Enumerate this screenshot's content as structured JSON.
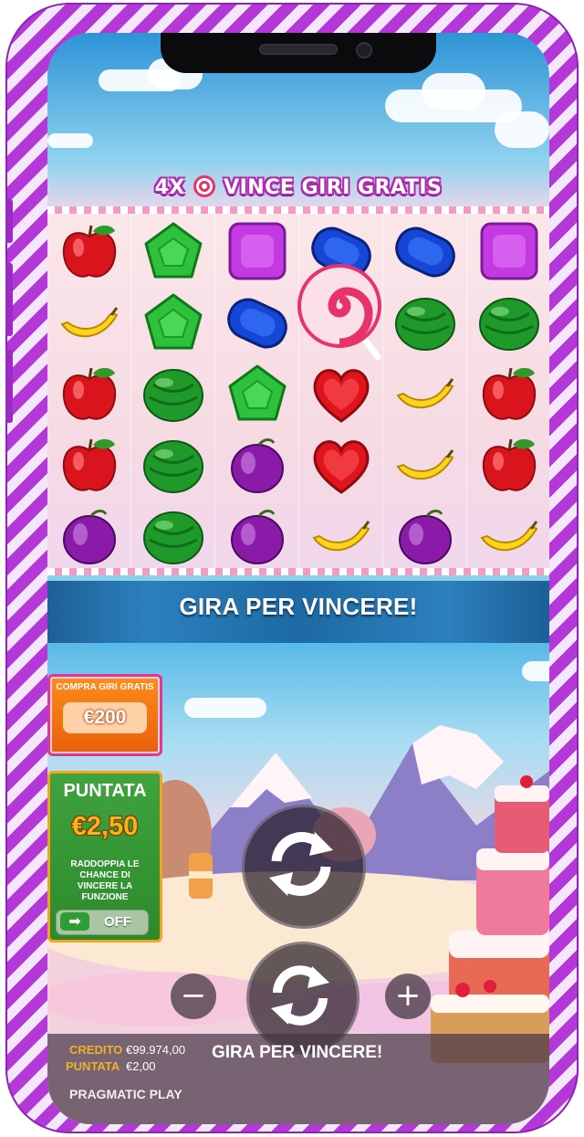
{
  "header_banner": {
    "prefix": "4X",
    "icon": "lollipop-icon",
    "text": "VINCE GIRI GRATIS"
  },
  "reels": [
    [
      "apple",
      "banana",
      "apple",
      "apple",
      "plum"
    ],
    [
      "green-pentagon",
      "green-pentagon",
      "watermelon",
      "watermelon",
      "watermelon"
    ],
    [
      "purple-square",
      "blue-oval",
      "green-pentagon",
      "plum",
      "plum"
    ],
    [
      "blue-oval",
      "lollipop",
      "red-heart",
      "red-heart",
      "banana"
    ],
    [
      "blue-oval",
      "watermelon",
      "banana",
      "banana",
      "plum"
    ],
    [
      "purple-square",
      "watermelon",
      "apple",
      "apple",
      "banana"
    ]
  ],
  "message_bar": "GIRA PER VINCERE!",
  "buy_feature": {
    "label": "COMPRA GIRI GRATIS",
    "price": "€200"
  },
  "bet_panel": {
    "title": "PUNTATA",
    "amount": "€2,50",
    "description_lines": [
      "RADDOPPIA LE",
      "CHANCE DI",
      "VINCERE LA",
      "FUNZIONE"
    ],
    "toggle_label": "OFF",
    "toggle_icon": "arrow-right-icon"
  },
  "controls": {
    "minus": "−",
    "plus": "+",
    "spin_icon": "refresh-icon"
  },
  "status": {
    "credit_label": "CREDITO",
    "credit_value": "€99.974,00",
    "bet_label": "PUNTATA",
    "bet_value": "€2,00",
    "message": "GIRA PER VINCERE!",
    "brand": "PRAGMATIC PLAY"
  },
  "colors": {
    "frame_stripe": "#b438d8",
    "bet_amount": "#f7b31a",
    "status_label": "#f1b02a"
  }
}
